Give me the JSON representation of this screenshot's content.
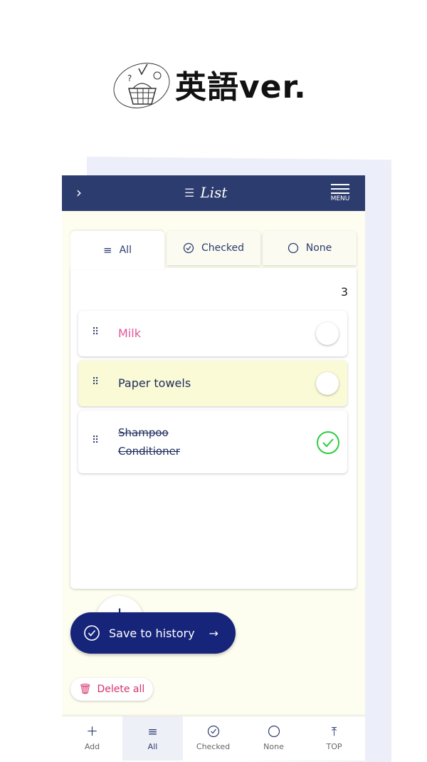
{
  "banner": {
    "title": "英語ver."
  },
  "appbar": {
    "title": "List",
    "back_icon": "chevron-right-icon",
    "menu_label": "MENU"
  },
  "tabs": [
    {
      "label": "All",
      "icon": "list-icon",
      "active": true
    },
    {
      "label": "Checked",
      "icon": "check-circle-icon",
      "active": false
    },
    {
      "label": "None",
      "icon": "circle-icon",
      "active": false
    }
  ],
  "list": {
    "count": "3",
    "items": [
      {
        "text": "Milk",
        "color": "#e0589a",
        "checked": false,
        "highlighted": false
      },
      {
        "text": "Paper towels",
        "color": "#1c2a5a",
        "checked": false,
        "highlighted": true
      },
      {
        "text": "Shampoo",
        "text2": "Conditioner",
        "color": "#1c2a5a",
        "checked": true,
        "highlighted": false
      }
    ]
  },
  "actions": {
    "save_label": "Save to history",
    "delete_label": "Delete all"
  },
  "bottom_nav": [
    {
      "label": "Add",
      "icon": "plus-icon"
    },
    {
      "label": "All",
      "icon": "list-icon",
      "active": true
    },
    {
      "label": "Checked",
      "icon": "check-circle-icon"
    },
    {
      "label": "None",
      "icon": "circle-icon"
    },
    {
      "label": "TOP",
      "icon": "arrow-up-to-top-icon"
    }
  ],
  "colors": {
    "appbar": "#2d3c6e",
    "accent": "#16247a",
    "highlight": "#fafad6",
    "check": "#2ecc40",
    "delete": "#d6336c"
  }
}
